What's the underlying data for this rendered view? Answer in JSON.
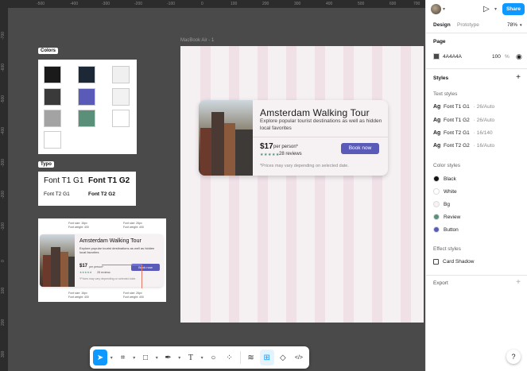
{
  "ruler": {
    "top": [
      "-500",
      "-400",
      "-300",
      "-200",
      "-100",
      "0",
      "100",
      "200",
      "300",
      "400",
      "500",
      "600",
      "700"
    ],
    "left": [
      "-700",
      "-600",
      "-500",
      "-400",
      "-300",
      "-200",
      "-100",
      "0",
      "100",
      "200",
      "300"
    ]
  },
  "frame": {
    "label": "MacBook Air - 1"
  },
  "card": {
    "title": "Amsterdam Walking Tour",
    "description": "Explore popular tourist destinations as well as hidden local favorites",
    "price": "$17",
    "per": "per person*",
    "stars": "★★★★★",
    "reviews": "28 reviews",
    "button": "Book now",
    "note": "*Prices may vary depending on selected date."
  },
  "colors_panel": {
    "label": "Colors",
    "swatches": [
      "#1a1a1a",
      "#1c2836",
      "#f0f0f0",
      "#3a3a3a",
      "#5a5bb8",
      "#f2f2f2",
      "#a3a3a3",
      "#5a8f7a",
      "#ffffff",
      "#ffffff"
    ]
  },
  "typo_panel": {
    "label": "Typo",
    "t1g1": "Font T1 G1",
    "t1g2": "Font T1 G2",
    "t2g1": "Font T2 G1",
    "t2g2": "Font T2 G2"
  },
  "spec": {
    "title": "Amsterdam Walking Tour",
    "description": "Explore popular tourist destinations as well as hidden local favorites",
    "price": "$17",
    "per": "per person*",
    "stars": "★★★★★",
    "reviews": "28 reviews",
    "button": "Book now",
    "note": "*Prices may vary depending on selected date.",
    "ann1a": "Font size: 16px",
    "ann1b": "Font weight: 400",
    "ann2a": "Font size: 26px",
    "ann2b": "Font weight: 400",
    "ann3a": "Font size: 16px",
    "ann3b": "Font weight: 400",
    "ann4a": "Font size: 26px",
    "ann4b": "Font weight: 400"
  },
  "right_panel": {
    "share": "Share",
    "zoom": "78%",
    "tab_design": "Design",
    "tab_prototype": "Prototype",
    "page_title": "Page",
    "page_color": "4A4A4A",
    "page_opacity": "100",
    "percent": "%",
    "styles_title": "Styles",
    "text_styles_title": "Text styles",
    "text_styles": [
      {
        "name": "Font T1 G1",
        "meta": "· 26/Auto"
      },
      {
        "name": "Font T1 G2",
        "meta": "· 26/Auto"
      },
      {
        "name": "Font T2 G1",
        "meta": "· 16/140"
      },
      {
        "name": "Font T2 G2",
        "meta": "· 16/Auto"
      }
    ],
    "color_styles_title": "Color styles",
    "color_styles": [
      {
        "name": "Black",
        "color": "#111111"
      },
      {
        "name": "White",
        "color": "#ffffff"
      },
      {
        "name": "Bg",
        "color": "#f7f2f4"
      },
      {
        "name": "Review",
        "color": "#5a8f7a"
      },
      {
        "name": "Button",
        "color": "#5a5bb8"
      }
    ],
    "effect_styles_title": "Effect styles",
    "effect_style": "Card Shadow",
    "export_title": "Export",
    "help": "?"
  }
}
